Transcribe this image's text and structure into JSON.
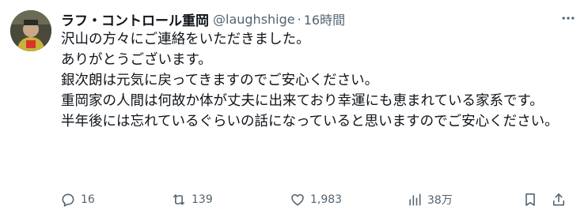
{
  "tweet": {
    "display_name": "ラフ・コントロール重岡",
    "handle": "@laughshige",
    "separator": "·",
    "time": "16時間",
    "body_lines": [
      "沢山の方々にご連絡をいただきました。",
      "ありがとうございます。",
      "銀次朗は元気に戻ってきますのでご安心ください。",
      "重岡家の人間は何故か体が丈夫に出来ており幸運にも恵まれている家系です。",
      "半年後には忘れているぐらいの話になっていると思いますのでご安心ください。"
    ]
  },
  "actions": {
    "reply_count": "16",
    "retweet_count": "139",
    "like_count": "1,983",
    "view_count": "38万"
  },
  "icons": {
    "more": "more-icon",
    "reply": "reply-icon",
    "retweet": "retweet-icon",
    "like": "heart-icon",
    "views": "views-icon",
    "bookmark": "bookmark-icon",
    "share": "share-icon"
  },
  "colors": {
    "text": "#0f1419",
    "secondary": "#536471"
  }
}
